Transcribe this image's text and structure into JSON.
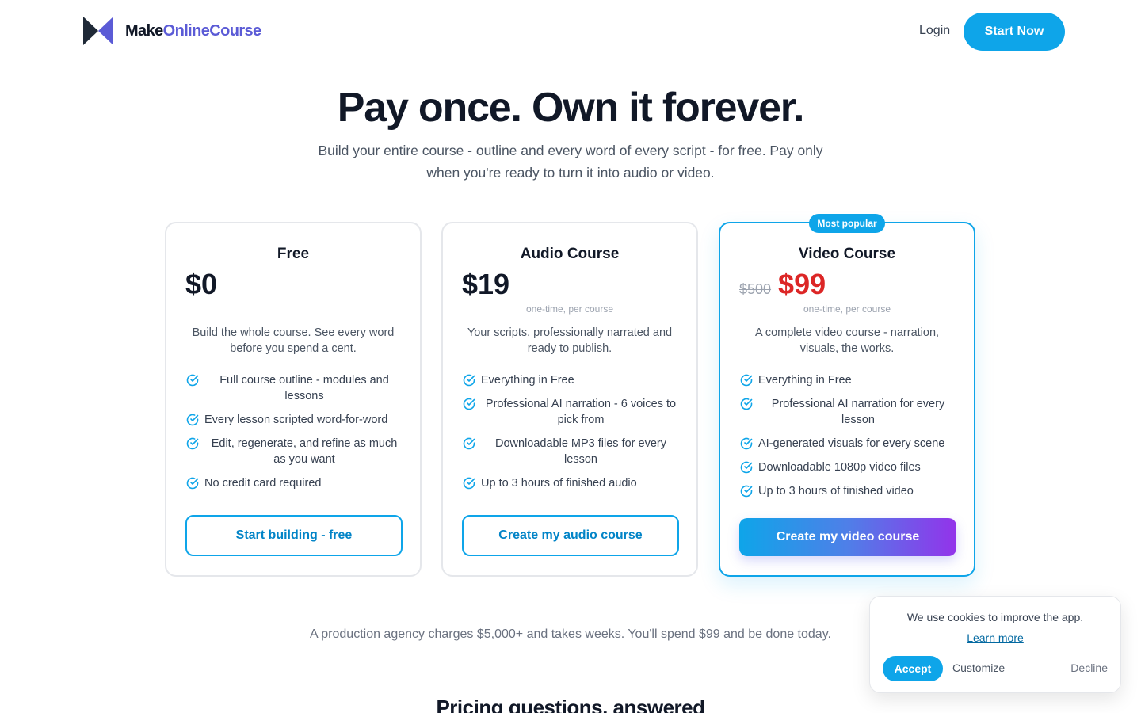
{
  "header": {
    "logo_part1": "Make",
    "logo_part2": "OnlineCourse",
    "login_label": "Login",
    "start_label": "Start Now"
  },
  "hero": {
    "title": "Pay once. Own it forever.",
    "subtitle": "Build your entire course - outline and every word of every script - for free. Pay only when you're ready to turn it into audio or video."
  },
  "plans": [
    {
      "name": "Free",
      "price": "$0",
      "description": "Build the whole course. See every word before you spend a cent.",
      "features": [
        "Full course outline - modules and lessons",
        "Every lesson scripted word-for-word",
        "Edit, regenerate, and refine as much as you want",
        "No credit card required"
      ],
      "cta": "Start building - free"
    },
    {
      "name": "Audio Course",
      "price": "$19",
      "period": "one-time, per course",
      "description": "Your scripts, professionally narrated and ready to publish.",
      "features": [
        "Everything in Free",
        "Professional AI narration - 6 voices to pick from",
        "Downloadable MP3 files for every lesson",
        "Up to 3 hours of finished audio"
      ],
      "cta": "Create my audio course"
    },
    {
      "badge": "Most popular",
      "name": "Video Course",
      "old_price": "$500",
      "price": "$99",
      "period": "one-time, per course",
      "description": "A complete video course - narration, visuals, the works.",
      "features": [
        "Everything in Free",
        "Professional AI narration for every lesson",
        "AI-generated visuals for every scene",
        "Downloadable 1080p video files",
        "Up to 3 hours of finished video"
      ],
      "cta": "Create my video course"
    }
  ],
  "note": "A production agency charges $5,000+ and takes weeks. You'll spend $99 and be done today.",
  "faq_title": "Pricing questions, answered",
  "cookie": {
    "message": "We use cookies to improve the app.",
    "learn_more": "Learn more",
    "accept": "Accept",
    "customize": "Customize",
    "decline": "Decline"
  },
  "colors": {
    "accent": "#0ea5e9",
    "brand_purple": "#5b5bd6",
    "sale_red": "#dc2626",
    "gradient_end": "#9333ea"
  },
  "icons": [
    "logo-mark-icon",
    "check-circle-icon"
  ]
}
